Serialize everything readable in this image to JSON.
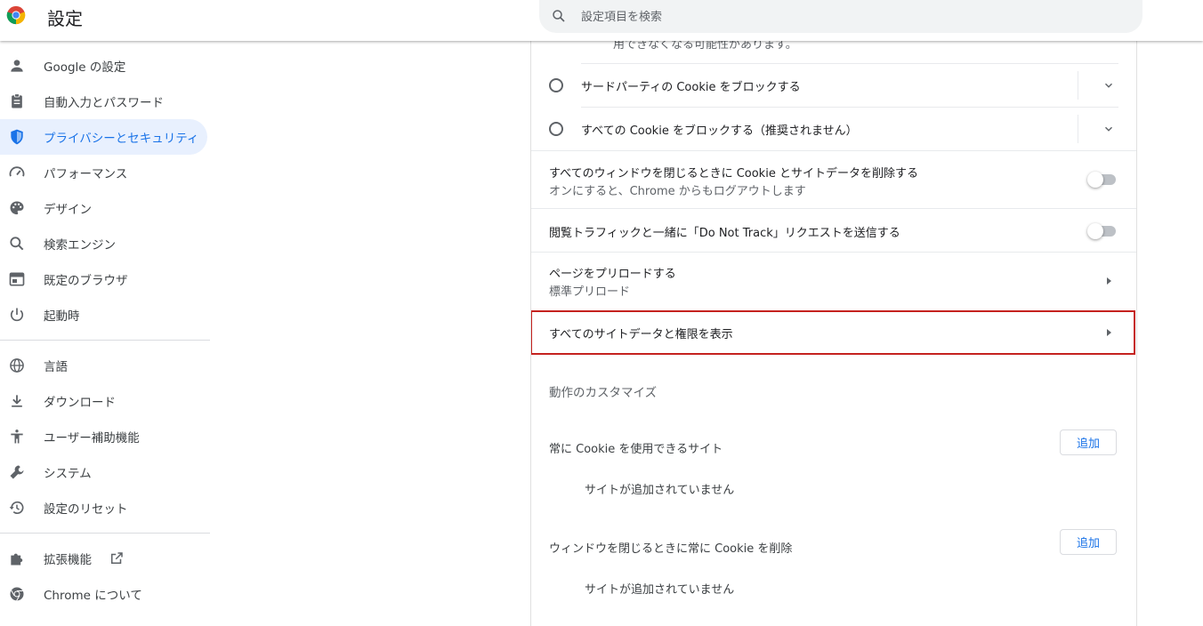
{
  "header": {
    "title": "設定",
    "search_placeholder": "設定項目を検索"
  },
  "sidebar": {
    "items": [
      {
        "label": "Google の設定",
        "icon": "person-icon"
      },
      {
        "label": "自動入力とパスワード",
        "icon": "clipboard-icon"
      },
      {
        "label": "プライバシーとセキュリティ",
        "icon": "shield-icon",
        "active": true
      },
      {
        "label": "パフォーマンス",
        "icon": "speedometer-icon"
      },
      {
        "label": "デザイン",
        "icon": "palette-icon"
      },
      {
        "label": "検索エンジン",
        "icon": "search-icon"
      },
      {
        "label": "既定のブラウザ",
        "icon": "browser-icon"
      },
      {
        "label": "起動時",
        "icon": "power-icon"
      },
      {
        "label": "言語",
        "icon": "globe-icon"
      },
      {
        "label": "ダウンロード",
        "icon": "download-icon"
      },
      {
        "label": "ユーザー補助機能",
        "icon": "accessibility-icon"
      },
      {
        "label": "システム",
        "icon": "wrench-icon"
      },
      {
        "label": "設定のリセット",
        "icon": "history-icon"
      },
      {
        "label": "拡張機能",
        "icon": "puzzle-icon"
      },
      {
        "label": "Chrome について",
        "icon": "chrome-icon"
      }
    ]
  },
  "main": {
    "truncated_text": "用できなくなる可能性があります。",
    "radio_third_party": "サードパーティの Cookie をブロックする",
    "radio_all": "すべての Cookie をブロックする（推奨されません）",
    "clear_on_exit": {
      "label": "すべてのウィンドウを閉じるときに Cookie とサイトデータを削除する",
      "sub": "オンにすると、Chrome からもログアウトします"
    },
    "dnt": {
      "label": "閲覧トラフィックと一緒に「Do Not Track」リクエストを送信する"
    },
    "preload": {
      "label": "ページをプリロードする",
      "sub": "標準プリロード"
    },
    "site_data": {
      "label": "すべてのサイトデータと権限を表示"
    },
    "customize_title": "動作のカスタマイズ",
    "allow_sites": {
      "label": "常に Cookie を使用できるサイト",
      "button": "追加",
      "empty": "サイトが追加されていません"
    },
    "clear_sites": {
      "label": "ウィンドウを閉じるときに常に Cookie を削除",
      "button": "追加",
      "empty": "サイトが追加されていません"
    }
  },
  "colors": {
    "accent": "#1a73e8",
    "highlight_border": "#c5221f"
  }
}
